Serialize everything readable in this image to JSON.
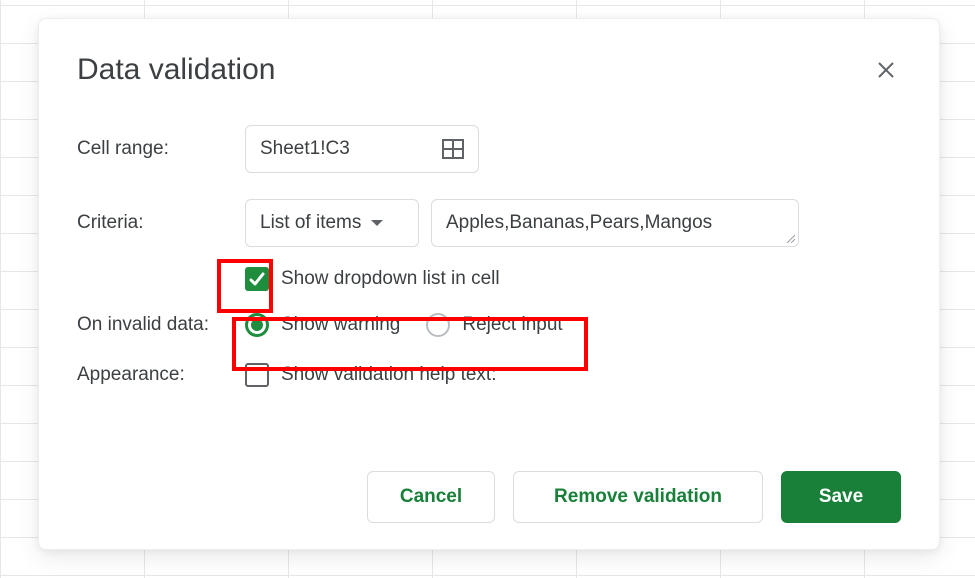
{
  "dialog": {
    "title": "Data validation",
    "close_icon": "close-icon"
  },
  "labels": {
    "cell_range": "Cell range:",
    "criteria": "Criteria:",
    "on_invalid_data": "On invalid data:",
    "appearance": "Appearance:"
  },
  "cell_range": {
    "value": "Sheet1!C3"
  },
  "criteria": {
    "selected_option": "List of items",
    "items_value": "Apples,Bananas,Pears,Mangos"
  },
  "show_dropdown": {
    "label": "Show dropdown list in cell",
    "checked": true
  },
  "invalid_data": {
    "show_warning_label": "Show warning",
    "reject_input_label": "Reject input",
    "selected": "show_warning"
  },
  "appearance": {
    "help_text_label": "Show validation help text:",
    "checked": false
  },
  "buttons": {
    "cancel": "Cancel",
    "remove": "Remove validation",
    "save": "Save"
  }
}
